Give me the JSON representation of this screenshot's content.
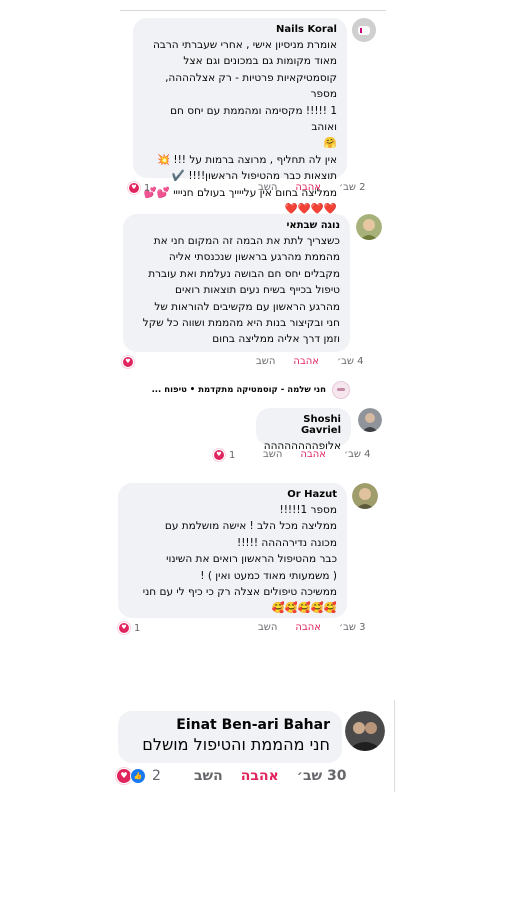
{
  "comments": [
    {
      "author": "Nails Koral",
      "text": "אומרת מניסיון אישי , אחרי שעברתי הרבה\nמאוד מקומות גם במכונים וגם אצל\nקוסמטיקאיות פרטיות - רק אצלהההה, מספר\n1 !!!!! מקסימה ומהממת עם יחס חם ואוהב\n🤗\nאין לה תחליף , מרוצה ברמות על !!! 💥\nתוצאות כבר מהטיפול הראשון!!!! ✔️\nממליצה בחום אין עלייייך בעולם חניייי 💕💕\n❤️❤️❤️❤️",
      "time": "2 שב׳",
      "love": "אהבה",
      "reply": "השב",
      "reactions": "1"
    },
    {
      "author": "נוגה שבתאי",
      "text": "כשצריך לתת את הבמה זה המקום חני את\nמהממת מהרגע בראשון שנכנסתי אליה\nמקבלים יחס חם הבושה נעלמת ואת עוברת\nטיפול בכייף בשיח נעים תוצאות רואים\nמהרגע הראשון עם מקשיבים להוראות של\nחני ובקיצור בנות היא מהממת ושווה כל שקל\nוזמן דרך אליה ממליצה בחום",
      "time": "4 שב׳",
      "love": "אהבה",
      "reply": "השב",
      "reactions": "1"
    },
    {
      "author": "Shoshi Gavriel",
      "text": "אלופהההההההה",
      "time": "4 שב׳",
      "love": "אהבה",
      "reply": "השב",
      "reactions": "1"
    },
    {
      "author": "Or Hazut",
      "text": "מספר 1!!!!!\nממליצה מכל הלב ! אישה מושלמת עם\nמכונה נדירהההה !!!!!\nכבר מהטיפול הראשון רואים את השינוי\n( משמעותי מאוד כמעט ואין ) !\nממשיכה טיפולים אצלה רק כי כיף לי עם חני\n🥰🥰🥰🥰🥰",
      "time": "3 שב׳",
      "love": "אהבה",
      "reply": "השב",
      "reactions": "1"
    },
    {
      "author": "Einat Ben-ari Bahar",
      "text": "חני מהממת והטיפול מושלם",
      "time": "30 שב׳",
      "love": "אהבה",
      "reply": "השב",
      "reactions": "2"
    }
  ],
  "page_reply": "חני שלמה - קוסמטיקה מתקדמת • טיפוח ...",
  "icons": {
    "love": "heart-reaction-icon",
    "like": "like-reaction-icon"
  },
  "colors": {
    "love": "#e0245e",
    "like": "#1877f2",
    "bubble": "#f0f2f5"
  }
}
